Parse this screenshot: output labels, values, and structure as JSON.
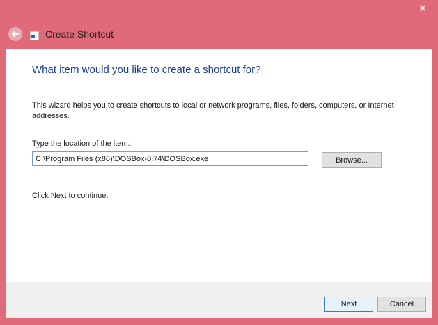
{
  "window": {
    "title": "Create Shortcut",
    "close_glyph": "✕",
    "back_glyph": "←"
  },
  "icons": {
    "back": "back-arrow-icon",
    "app": "shortcut-icon",
    "close": "close-icon"
  },
  "content": {
    "heading": "What item would you like to create a shortcut for?",
    "description": "This wizard helps you to create shortcuts to local or network programs, files, folders, computers, or Internet addresses.",
    "location_label": "Type the location of the item:",
    "location_value": "C:\\Program Files (x86)\\DOSBox-0.74\\DOSBox.exe",
    "browse_label": "Browse...",
    "hint": "Click Next to continue."
  },
  "footer": {
    "next_label": "Next",
    "cancel_label": "Cancel"
  },
  "colors": {
    "frame": "#e06a79",
    "heading": "#1c3f94",
    "footer": "#f0f0f0"
  }
}
